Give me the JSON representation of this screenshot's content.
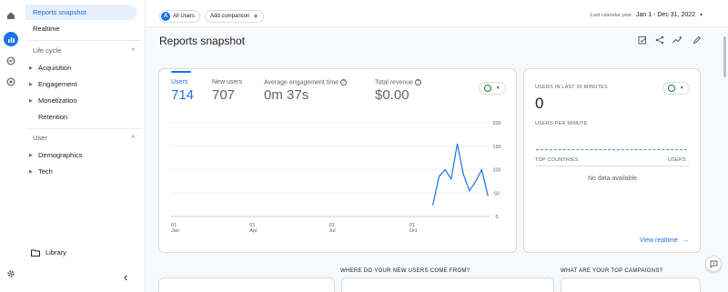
{
  "nav": {
    "items": {
      "reports_snapshot": "Reports snapshot",
      "realtime": "Realtime",
      "lifecycle": "Life cycle",
      "acquisition": "Acquisition",
      "engagement": "Engagement",
      "monetization": "Monetization",
      "retention": "Retention",
      "user": "User",
      "demographics": "Demographics",
      "tech": "Tech",
      "library": "Library"
    },
    "collapse_glyph": "‹",
    "section_caret": "^"
  },
  "topbar": {
    "audience_chip": "All Users",
    "audience_initial": "A",
    "add_comparison": "Add comparison",
    "add_comparison_plus": "+",
    "date_label": "Last calendar year",
    "date_range": "Jan 1 - Dec 31, 2022",
    "date_caret": "▾"
  },
  "page": {
    "title": "Reports snapshot"
  },
  "metrics": [
    {
      "label": "Users",
      "value": "714"
    },
    {
      "label": "New users",
      "value": "707"
    },
    {
      "label": "Average engagement time",
      "value": "0m 37s"
    },
    {
      "label": "Total revenue",
      "value": "$0.00"
    }
  ],
  "realtime": {
    "users_30_label": "USERS IN LAST 30 MINUTES",
    "users_30_value": "0",
    "per_minute_label": "USERS PER MINUTE",
    "top_countries_label": "TOP COUNTRIES",
    "users_col_label": "USERS",
    "no_data": "No data available",
    "view_link": "View realtime",
    "view_arrow": "→"
  },
  "bottom": {
    "new_users_q": "WHERE DO YOUR NEW USERS COME FROM?",
    "campaigns_q": "WHAT ARE YOUR TOP CAMPAIGNS?"
  },
  "chart_data": {
    "type": "line",
    "x_ticks": [
      {
        "day": "01",
        "month": "Jan"
      },
      {
        "day": "01",
        "month": "Apr"
      },
      {
        "day": "01",
        "month": "Jul"
      },
      {
        "day": "01",
        "month": "Oct"
      }
    ],
    "y_ticks": [
      "200",
      "150",
      "100",
      "50",
      "0"
    ],
    "ylim": [
      0,
      200
    ],
    "series": [
      {
        "color": "#1a73e8",
        "x": [
          "2022-10-28",
          "2022-11-04",
          "2022-11-11",
          "2022-11-18",
          "2022-11-25",
          "2022-12-02",
          "2022-12-09",
          "2022-12-16",
          "2022-12-23",
          "2022-12-30"
        ],
        "values": [
          25,
          85,
          100,
          80,
          155,
          90,
          55,
          75,
          100,
          45
        ]
      }
    ],
    "grid": true
  },
  "colors": {
    "accent": "#1a73e8",
    "success": "#188038"
  }
}
